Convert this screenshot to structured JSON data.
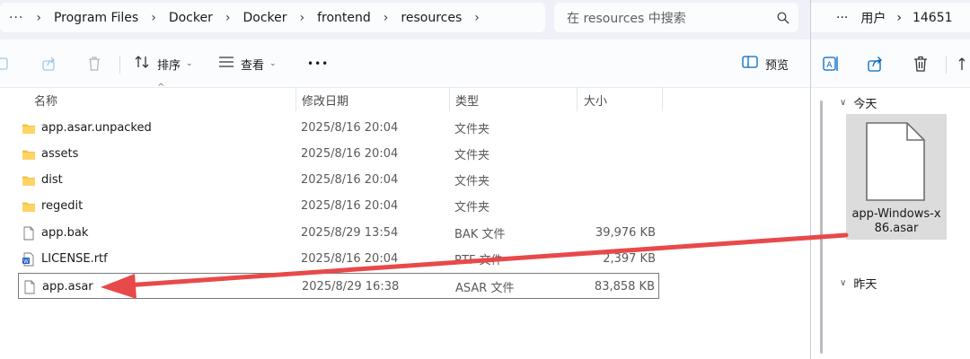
{
  "left": {
    "breadcrumb": [
      "Program Files",
      "Docker",
      "Docker",
      "frontend",
      "resources"
    ],
    "search_placeholder": "在 resources 中搜索",
    "toolbar": {
      "sort_label": "排序",
      "view_label": "查看",
      "more_label": "•••",
      "preview_label": "预览"
    },
    "columns": {
      "name": "名称",
      "date": "修改日期",
      "type": "类型",
      "size": "大小"
    },
    "files": [
      {
        "name": "app.asar.unpacked",
        "date": "2025/8/16 20:04",
        "type": "文件夹",
        "size": "",
        "icon": "folder-icon"
      },
      {
        "name": "assets",
        "date": "2025/8/16 20:04",
        "type": "文件夹",
        "size": "",
        "icon": "folder-icon"
      },
      {
        "name": "dist",
        "date": "2025/8/16 20:04",
        "type": "文件夹",
        "size": "",
        "icon": "folder-icon"
      },
      {
        "name": "regedit",
        "date": "2025/8/16 20:04",
        "type": "文件夹",
        "size": "",
        "icon": "folder-icon"
      },
      {
        "name": "app.bak",
        "date": "2025/8/29 13:54",
        "type": "BAK 文件",
        "size": "39,976 KB",
        "icon": "file-icon"
      },
      {
        "name": "LICENSE.rtf",
        "date": "2025/8/16 20:04",
        "type": "RTF 文件",
        "size": "2,397 KB",
        "icon": "word-doc-icon"
      },
      {
        "name": "app.asar",
        "date": "2025/8/29 16:38",
        "type": "ASAR 文件",
        "size": "83,858 KB",
        "icon": "file-icon",
        "selected": true
      }
    ]
  },
  "right": {
    "breadcrumb": [
      "用户",
      "14651"
    ],
    "groups": {
      "today": "今天",
      "yesterday": "昨天"
    },
    "file_tile": {
      "name": "app-Windows-x86.asar",
      "line1": "app-Windows-x",
      "line2": "86.asar",
      "icon": "file-icon"
    }
  },
  "colors": {
    "arrow": "#e8494a",
    "folder": "#f4c245",
    "accent": "#0067c0"
  }
}
